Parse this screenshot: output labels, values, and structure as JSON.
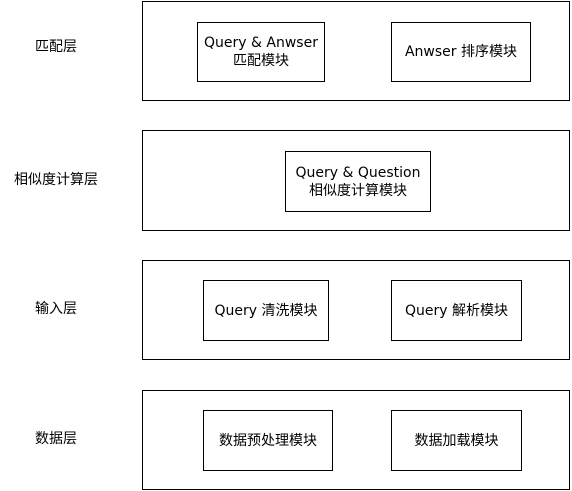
{
  "layers": [
    {
      "label": "匹配层",
      "modules": [
        "Query & Anwser\n匹配模块",
        "Anwser 排序模块"
      ]
    },
    {
      "label": "相似度计算层",
      "modules": [
        "Query & Question\n相似度计算模块"
      ]
    },
    {
      "label": "输入层",
      "modules": [
        "Query 清洗模块",
        "Query 解析模块"
      ]
    },
    {
      "label": "数据层",
      "modules": [
        "数据预处理模块",
        "数据加载模块"
      ]
    }
  ]
}
